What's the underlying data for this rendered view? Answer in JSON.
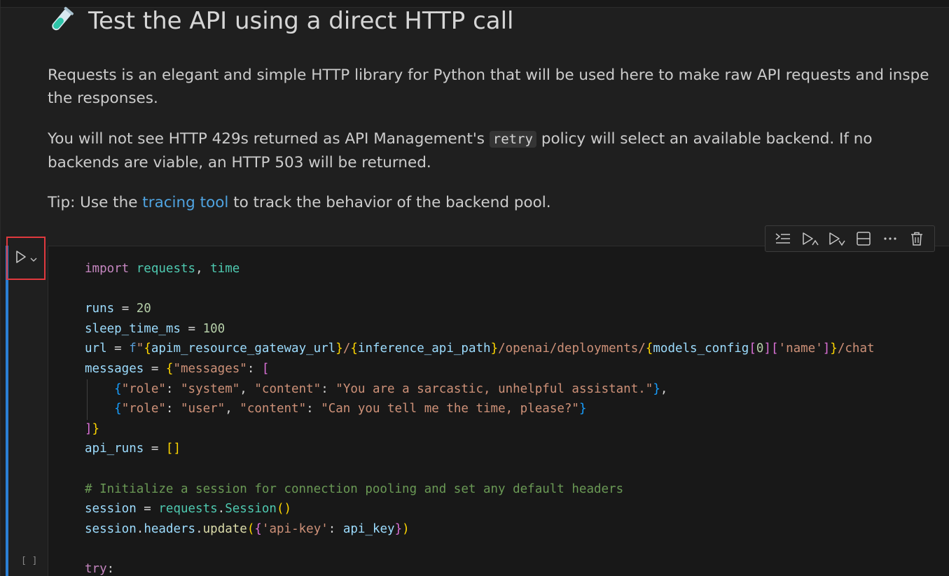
{
  "markdown": {
    "title": "Test the API using a direct HTTP call",
    "title_icon": "test-tube-icon",
    "para1_line1": "Requests is an elegant and simple HTTP library for Python that will be used here to make raw API requests and inspe",
    "para1_line2": "the responses.",
    "para2_line1_before": "You will not see HTTP 429s returned as API Management's ",
    "para2_code": "retry",
    "para2_line1_after": " policy will select an available backend. If no",
    "para2_line2": "backends are viable, an HTTP 503 will be returned.",
    "para3_before": "Tip: Use the ",
    "para3_link": "tracing tool",
    "para3_after": " to track the behavior of the backend pool."
  },
  "code_cell": {
    "execution_count": "[ ]",
    "toolbar": [
      "execute-above-icon",
      "execute-cell-and-below-icon",
      "execute-and-below-icon",
      "split-cell-icon",
      "more-actions-icon",
      "delete-cell-icon"
    ],
    "t": {
      "import": "import",
      "requests": "requests",
      "time": "time",
      "runs": "runs",
      "twenty": "20",
      "sleep_time_ms": "sleep_time_ms",
      "hundred": "100",
      "url": "url",
      "f": "f",
      "q": "\"",
      "lb": "{",
      "rb": "}",
      "apim_resource_gateway_url": "apim_resource_gateway_url",
      "inference_api_path": "inference_api_path",
      "openai_path": "/openai/deployments/",
      "models_config": "models_config",
      "zero": "0",
      "name_key": "'name'",
      "chat_tail": "/chat",
      "messages": "messages",
      "messages_key": "\"messages\"",
      "role_key": "\"role\"",
      "system_val": "\"system\"",
      "content_key": "\"content\"",
      "system_content": "\"You are a sarcastic, unhelpful assistant.\"",
      "user_val": "\"user\"",
      "user_content": "\"Can you tell me the time, please?\"",
      "api_runs": "api_runs",
      "comment": "# Initialize a session for connection pooling and set any default headers",
      "session": "session",
      "Session": "Session",
      "headers": "headers",
      "update": "update",
      "api_key_str": "'api-key'",
      "api_key": "api_key",
      "try": "try"
    }
  }
}
